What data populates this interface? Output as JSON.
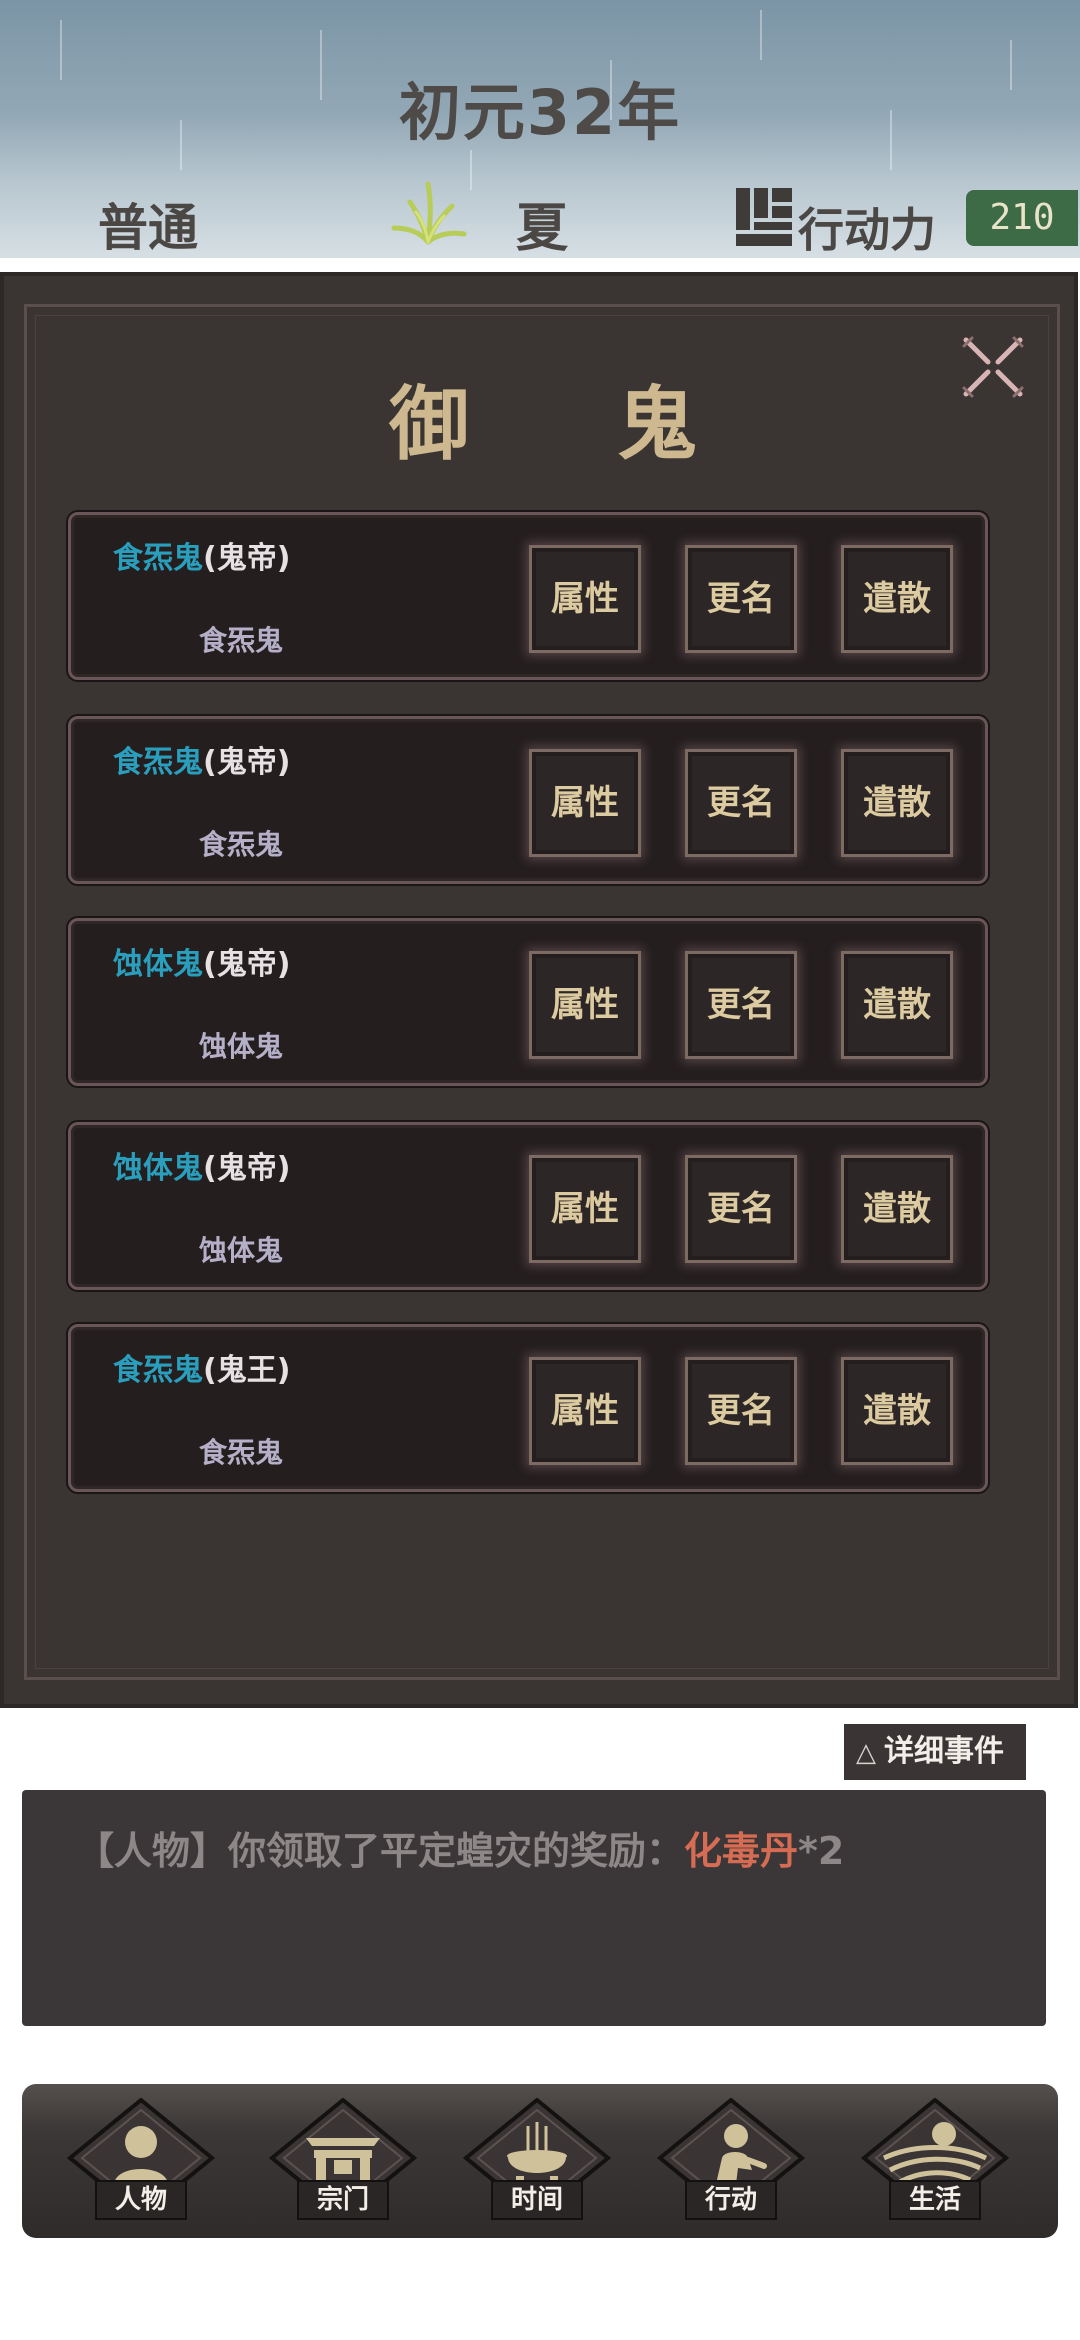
{
  "header": {
    "year": "初元32年",
    "difficulty": "普通",
    "season": "夏",
    "action_points_label": "行动力",
    "action_points_value": "210"
  },
  "dialog": {
    "title": "御 鬼",
    "rows": [
      {
        "name": "食炁鬼",
        "rank": "(鬼帝)",
        "type": "食炁鬼",
        "btn_attr": "属性",
        "btn_rename": "更名",
        "btn_dismiss": "遣散"
      },
      {
        "name": "食炁鬼",
        "rank": "(鬼帝)",
        "type": "食炁鬼",
        "btn_attr": "属性",
        "btn_rename": "更名",
        "btn_dismiss": "遣散"
      },
      {
        "name": "蚀体鬼",
        "rank": "(鬼帝)",
        "type": "蚀体鬼",
        "btn_attr": "属性",
        "btn_rename": "更名",
        "btn_dismiss": "遣散"
      },
      {
        "name": "蚀体鬼",
        "rank": "(鬼帝)",
        "type": "蚀体鬼",
        "btn_attr": "属性",
        "btn_rename": "更名",
        "btn_dismiss": "遣散"
      },
      {
        "name": "食炁鬼",
        "rank": "(鬼王)",
        "type": "食炁鬼",
        "btn_attr": "属性",
        "btn_rename": "更名",
        "btn_dismiss": "遣散"
      }
    ]
  },
  "events": {
    "detail_button": "详细事件",
    "log_prefix": "【人物】你领取了平定蝗灾的奖励：",
    "log_item": "化毒丹",
    "log_suffix": "*2"
  },
  "nav": {
    "items": [
      {
        "label": "人物",
        "icon": "person-icon"
      },
      {
        "label": "宗门",
        "icon": "sect-gate-icon"
      },
      {
        "label": "时间",
        "icon": "incense-burner-icon"
      },
      {
        "label": "行动",
        "icon": "action-figure-icon"
      },
      {
        "label": "生活",
        "icon": "landscape-sun-icon"
      }
    ]
  },
  "colors": {
    "ghost_name": "#2a9fbd",
    "reward_item": "#d56c53",
    "action_points_bg": "#3c6b45",
    "button_text": "#dccaa0"
  }
}
